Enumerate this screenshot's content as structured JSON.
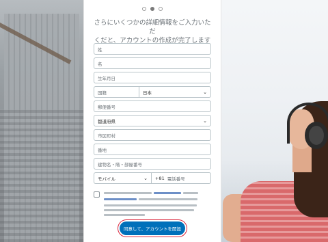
{
  "stepper": {
    "total": 3,
    "current": 2
  },
  "heading": {
    "line1": "さらにいくつかの詳細情報をご入力いただ",
    "line2": "くだと、アカウントの作成が完了します"
  },
  "form": {
    "last_name_placeholder": "姓",
    "first_name_placeholder": "名",
    "birthdate_placeholder": "生年月日",
    "nationality_label": "国籍",
    "nationality_value": "日本",
    "postal_code_placeholder": "郵便番号",
    "prefecture_value": "都道府県",
    "city_placeholder": "市区町村",
    "address_number_placeholder": "番地",
    "building_placeholder": "建物名・階・部屋番号",
    "phone_type_value": "モバイル",
    "country_code": "+81",
    "phone_placeholder": "電話番号"
  },
  "consent": {
    "checked": false
  },
  "primary_button": {
    "label": "同意して、アカウントを開設"
  },
  "colors": {
    "brand": "#0070ba",
    "highlight": "#d9233a"
  },
  "icons": {
    "dropdown": "chevron-down-icon"
  }
}
